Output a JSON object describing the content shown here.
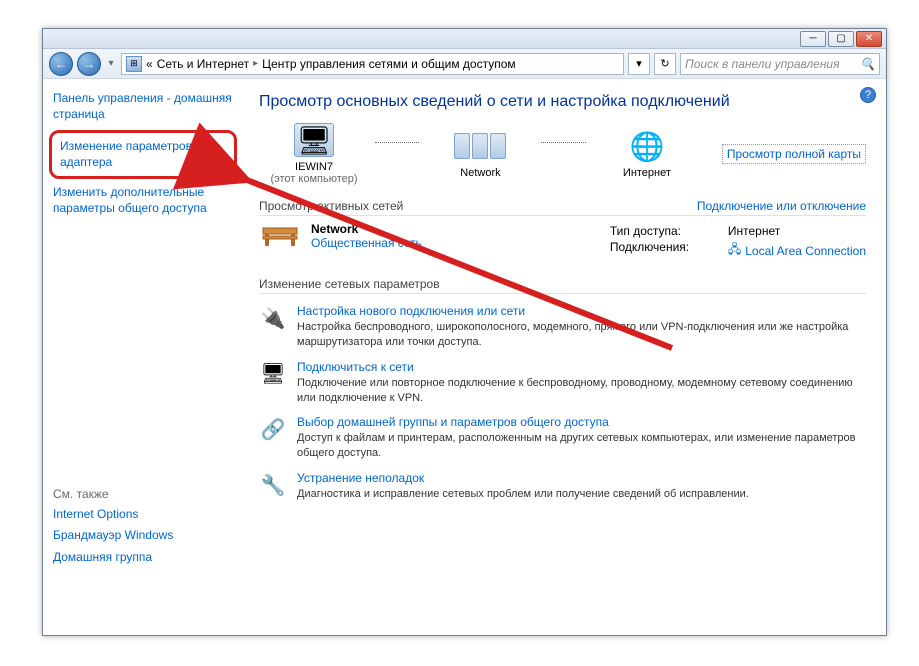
{
  "breadcrumb": {
    "prefix": "«",
    "part1": "Сеть и Интернет",
    "part2": "Центр управления сетями и общим доступом"
  },
  "search": {
    "placeholder": "Поиск в панели управления"
  },
  "sidebar": {
    "home": "Панель управления - домашняя страница",
    "adapter": "Изменение параметров адаптера",
    "sharing": "Изменить дополнительные параметры общего доступа",
    "seealso_label": "См. также",
    "seealso": {
      "i0": "Internet Options",
      "i1": "Брандмауэр Windows",
      "i2": "Домашняя группа"
    }
  },
  "main": {
    "title": "Просмотр основных сведений о сети и настройка подключений",
    "map": {
      "this_pc": "IEWIN7",
      "this_pc_sub": "(этот компьютер)",
      "network": "Network",
      "internet": "Интернет",
      "fullmap": "Просмотр полной карты"
    },
    "sec_active": "Просмотр активных сетей",
    "sec_active_link": "Подключение или отключение",
    "net": {
      "name": "Network",
      "category": "Общественная сеть",
      "access_lbl": "Тип доступа:",
      "access_val": "Интернет",
      "conn_lbl": "Подключения:",
      "conn_val": "Local Area Connection"
    },
    "sec_change": "Изменение сетевых параметров",
    "opts": {
      "o0": {
        "t": "Настройка нового подключения или сети",
        "d": "Настройка беспроводного, широкополосного, модемного, прямого или VPN-подключения или же настройка маршрутизатора или точки доступа."
      },
      "o1": {
        "t": "Подключиться к сети",
        "d": "Подключение или повторное подключение к беспроводному, проводному, модемному сетевому соединению или подключение к VPN."
      },
      "o2": {
        "t": "Выбор домашней группы и параметров общего доступа",
        "d": "Доступ к файлам и принтерам, расположенным на других сетевых компьютерах, или изменение параметров общего доступа."
      },
      "o3": {
        "t": "Устранение неполадок",
        "d": "Диагностика и исправление сетевых проблем или получение сведений об исправлении."
      }
    }
  }
}
